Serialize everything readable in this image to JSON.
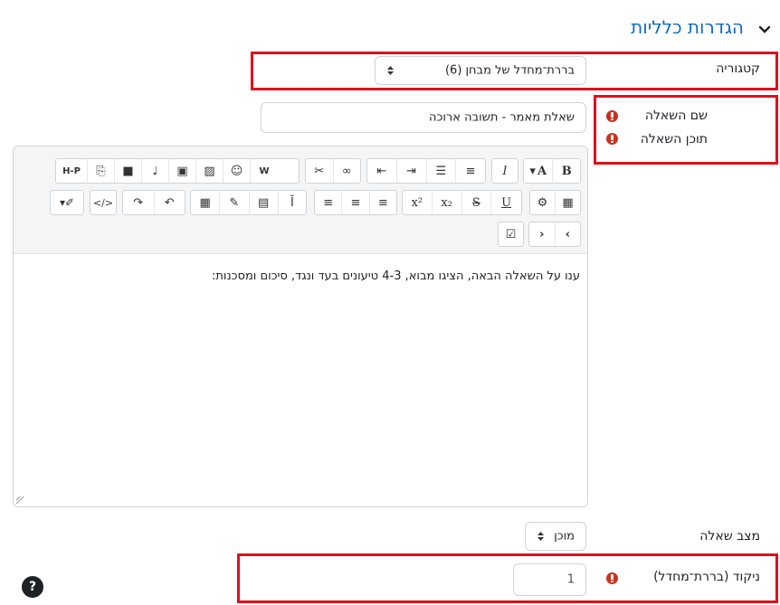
{
  "section": {
    "title": "הגדרות כלליות"
  },
  "category": {
    "label": "קטגוריה",
    "value": "בררת־מחדל של מבחן (6)"
  },
  "question_name": {
    "label": "שם השאלה",
    "value": "שאלת מאמר - תשובה ארוכה"
  },
  "question_text": {
    "label": "תוכן השאלה",
    "content": "ענו על השאלה הבאה, הציגו מבוא, 4-3 טיעונים בעד ונגד, סיכום ומסכנות:"
  },
  "toolbar": {
    "font_size_label": "A",
    "bold_label": "B",
    "italic_label": "I",
    "superscript_label": "x²",
    "subscript_label": "x₂",
    "underline_label": "U",
    "strike_label": "S",
    "code_label": "</>",
    "h5p_label": "H-P"
  },
  "status": {
    "label": "מצב שאלה",
    "value": "מוכן"
  },
  "default_mark": {
    "label": "ניקוד (בררת־מחדל)",
    "value": "1"
  },
  "help": {
    "label": "?"
  }
}
